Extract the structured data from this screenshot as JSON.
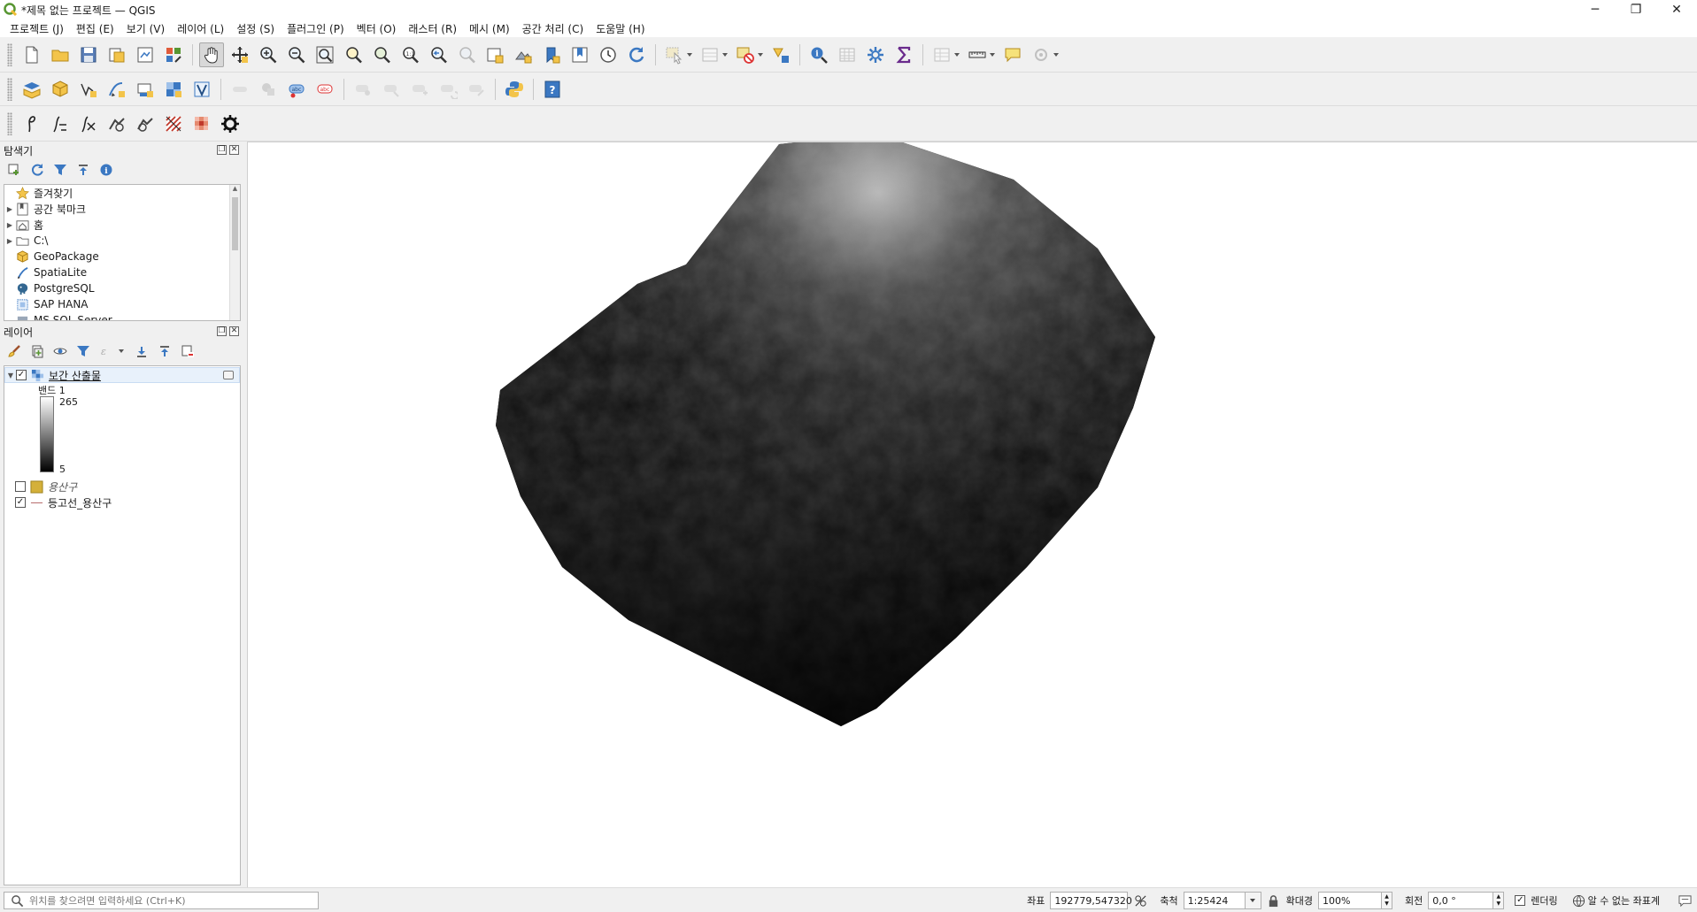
{
  "window": {
    "title": "*제목 없는 프로젝트 — QGIS",
    "minimize": "─",
    "restore": "❐",
    "close": "✕"
  },
  "menu": [
    {
      "label": "프로젝트 (J)"
    },
    {
      "label": "편집 (E)"
    },
    {
      "label": "보기 (V)"
    },
    {
      "label": "레이어 (L)"
    },
    {
      "label": "설정 (S)"
    },
    {
      "label": "플러그인 (P)"
    },
    {
      "label": "벡터 (O)"
    },
    {
      "label": "래스터 (R)"
    },
    {
      "label": "메시 (M)"
    },
    {
      "label": "공간 처리 (C)"
    },
    {
      "label": "도움말 (H)"
    }
  ],
  "browser_panel": {
    "title": "탐색기",
    "items": [
      {
        "label": "즐겨찾기",
        "icon": "star-icon",
        "expandable": false
      },
      {
        "label": "공간 북마크",
        "icon": "bookmark-icon",
        "expandable": true
      },
      {
        "label": "홈",
        "icon": "home-folder-icon",
        "expandable": true
      },
      {
        "label": "C:\\",
        "icon": "folder-icon",
        "expandable": true
      },
      {
        "label": "GeoPackage",
        "icon": "geopackage-icon",
        "expandable": false
      },
      {
        "label": "SpatiaLite",
        "icon": "spatialite-icon",
        "expandable": false
      },
      {
        "label": "PostgreSQL",
        "icon": "postgresql-icon",
        "expandable": false
      },
      {
        "label": "SAP HANA",
        "icon": "sap-hana-icon",
        "expandable": false
      },
      {
        "label": "MS SQL Server",
        "icon": "mssql-icon",
        "expandable": false
      }
    ]
  },
  "layers_panel": {
    "title": "레이어",
    "layers": [
      {
        "name": "보간 산출물",
        "checked": true,
        "type": "raster"
      },
      {
        "name": "용산구",
        "checked": false,
        "type": "polygon"
      },
      {
        "name": "등고선_용산구",
        "checked": true,
        "type": "line"
      }
    ],
    "legend": {
      "band_label": "밴드 1",
      "max": "265",
      "min": "5"
    }
  },
  "statusbar": {
    "locator_placeholder": "위치를 찾으려면 입력하세요 (Ctrl+K)",
    "coord_label": "좌표",
    "coord_value": "192779,547320",
    "scale_label": "축척",
    "scale_value": "1:25424",
    "magnifier_label": "확대경",
    "magnifier_value": "100%",
    "rotation_label": "회전",
    "rotation_value": "0,0 °",
    "render_label": "렌더링",
    "render_checked": true,
    "crs_label": "알 수 없는 좌표계"
  },
  "colors": {
    "accent": "#3b78c2",
    "qgis_green": "#589632",
    "qgis_yellow": "#eebc33"
  }
}
